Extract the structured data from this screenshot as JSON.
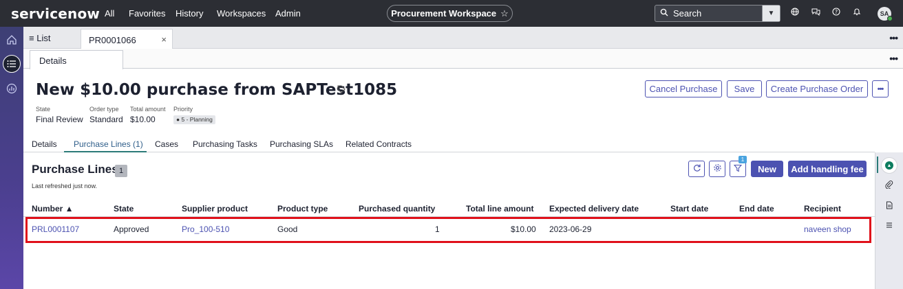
{
  "topnav": {
    "logo": "servicenow",
    "items": [
      "All",
      "Favorites",
      "History",
      "Workspaces",
      "Admin"
    ],
    "workspace_label": "Procurement Workspace",
    "workspace_star": "☆",
    "search_label": "Search",
    "avatar_initials": "SA"
  },
  "tabs": {
    "list_label": "List",
    "record_label": "PR0001066",
    "close": "×",
    "more": "•••"
  },
  "subtabs": {
    "details_label": "Details",
    "more": "•••"
  },
  "record": {
    "title": "New $10.00 purchase from SAPTest1085",
    "meta": {
      "state_label": "State",
      "state_value": "Final Review",
      "order_type_label": "Order type",
      "order_type_value": "Standard",
      "total_label": "Total amount",
      "total_value": "$10.00",
      "priority_label": "Priority",
      "priority_value": "5 - Planning"
    },
    "buttons": {
      "cancel": "Cancel Purchase",
      "save": "Save",
      "create_po": "Create Purchase Order",
      "more": "•••"
    }
  },
  "section_tabs": [
    "Details",
    "Purchase Lines (1)",
    "Cases",
    "Purchasing Tasks",
    "Purchasing SLAs",
    "Related Contracts"
  ],
  "related_list": {
    "title": "Purchase Lines",
    "count": "1",
    "refreshed": "Last refreshed just now.",
    "filter_count": "1",
    "new_label": "New",
    "handling_fee_label": "Add handling fee",
    "columns": [
      "Number ▲",
      "State",
      "Supplier product",
      "Product type",
      "Purchased quantity",
      "Total line amount",
      "Expected delivery date",
      "Start date",
      "End date",
      "Recipient"
    ],
    "rows": [
      {
        "number": "PRL0001107",
        "state": "Approved",
        "supplier_product": "Pro_100-510",
        "product_type": "Good",
        "quantity": "1",
        "total": "$10.00",
        "expected_delivery": "2023-06-29",
        "start_date": "",
        "end_date": "",
        "recipient": "naveen shop"
      }
    ]
  },
  "colors": {
    "nav_bg": "#2c2e34",
    "accent": "#4c52b1",
    "highlight": "#e0101a",
    "tab_underline": "#2b7a78"
  }
}
